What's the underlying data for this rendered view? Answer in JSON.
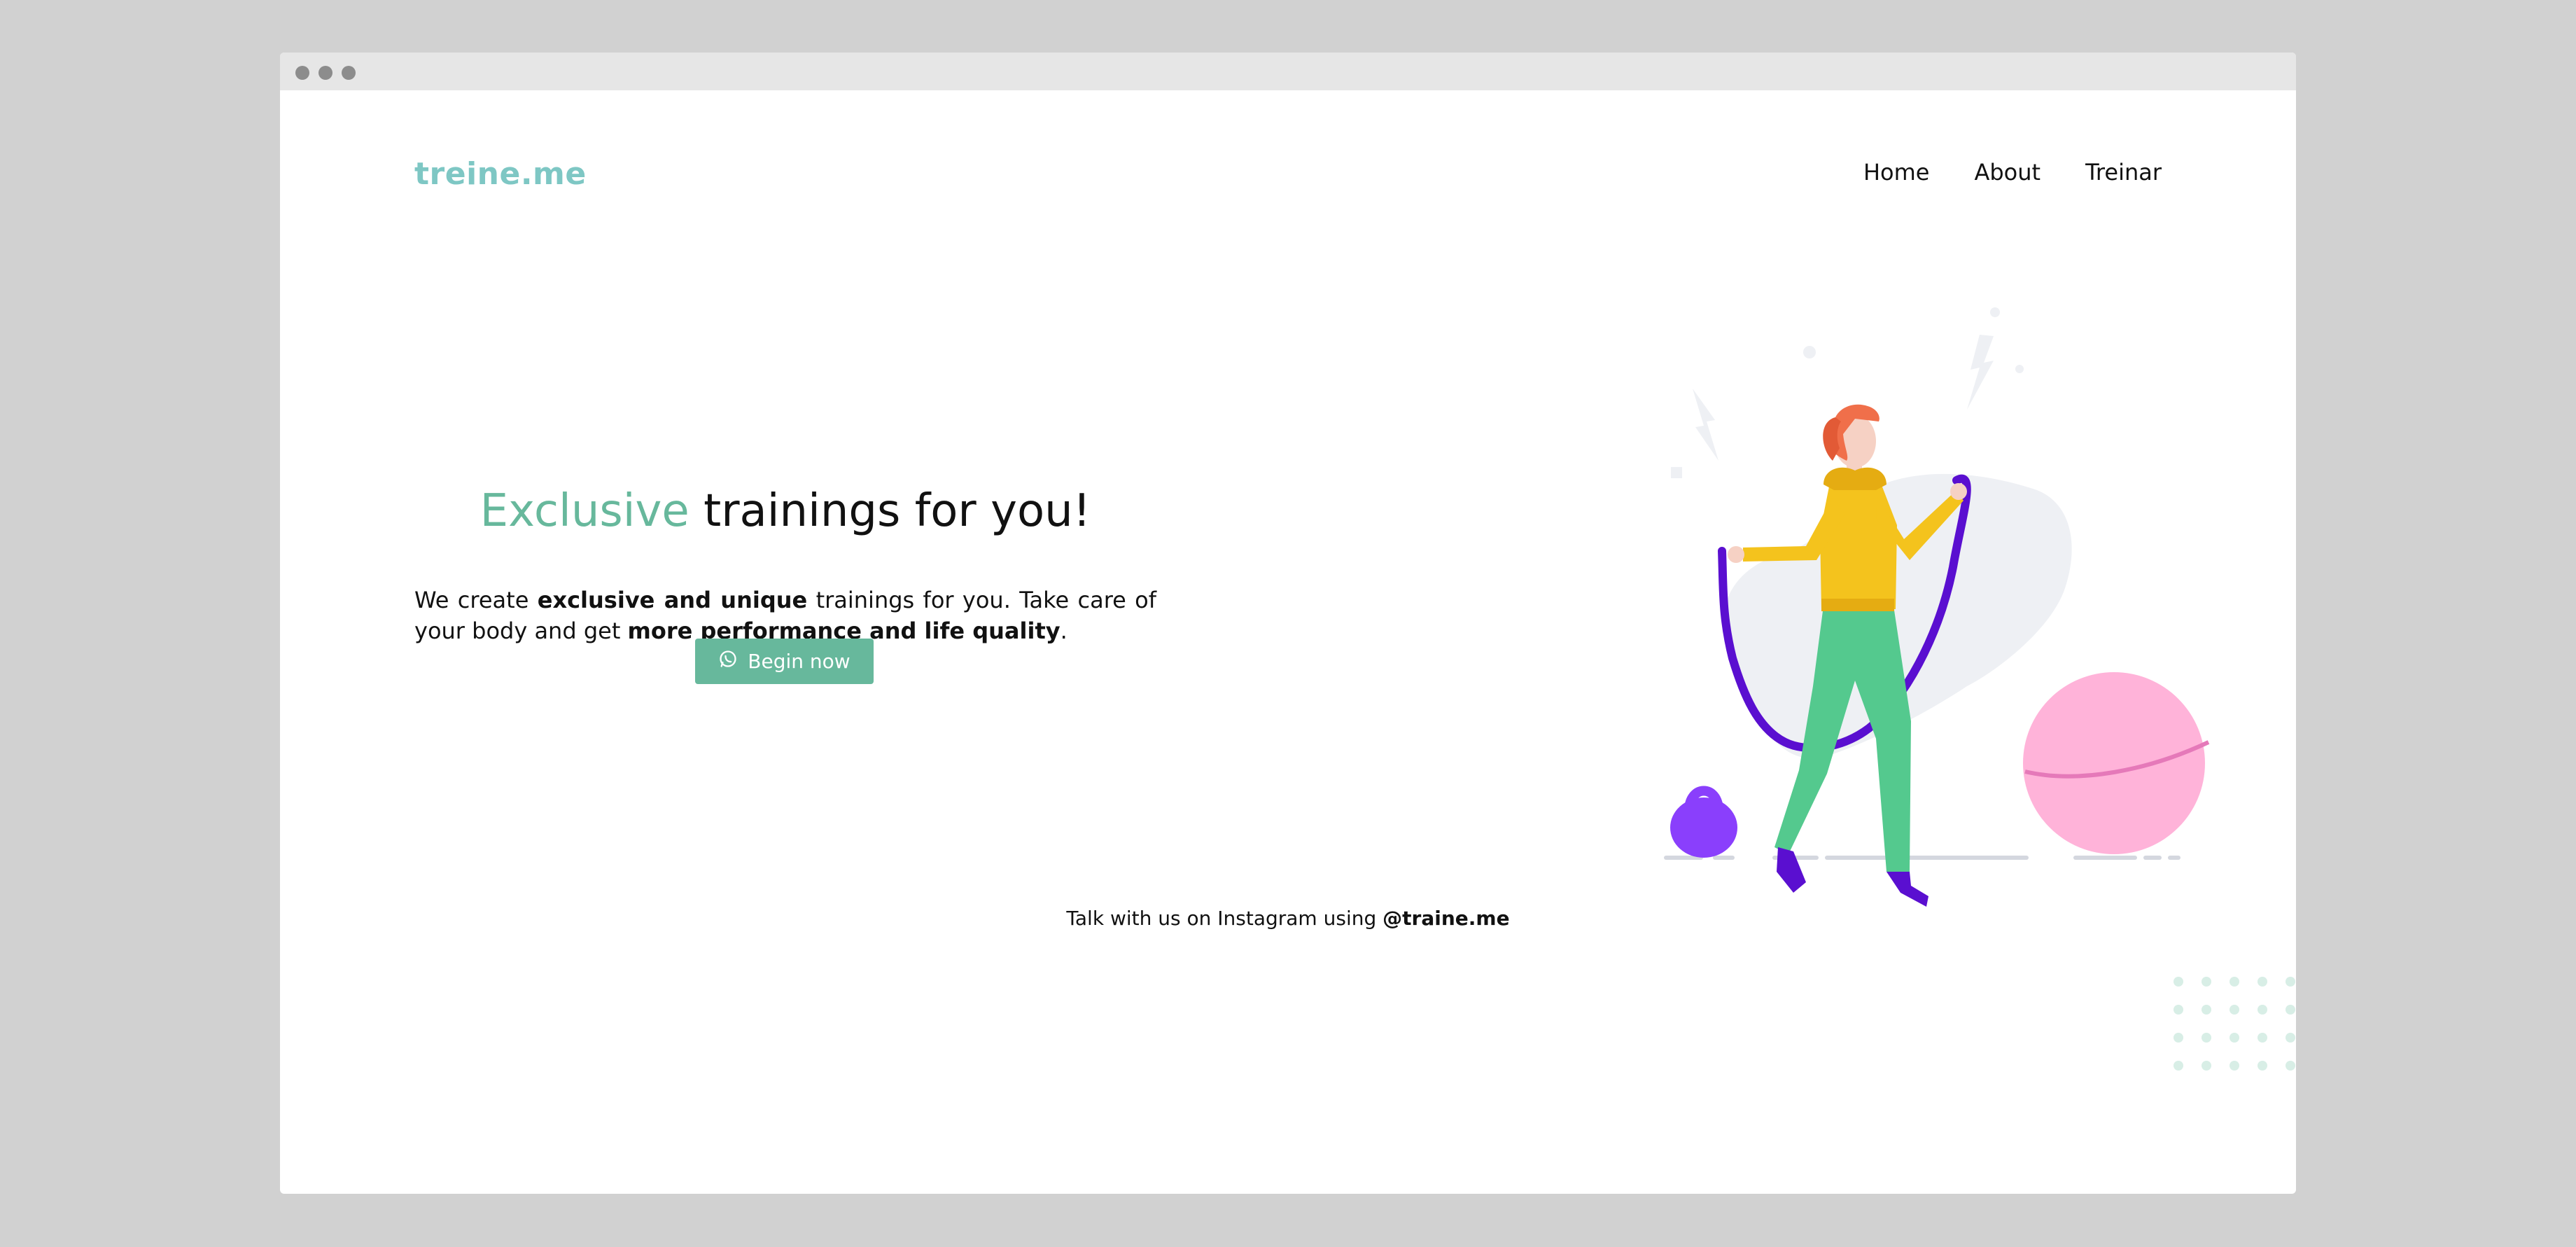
{
  "brand": {
    "logo": "treine.me",
    "accent_color": "#67b89c",
    "logo_color": "#7ec7c4"
  },
  "nav": {
    "items": [
      "Home",
      "About",
      "Treinar"
    ]
  },
  "hero": {
    "title_accent": "Exclusive",
    "title_rest": " trainings for you!",
    "desc_1": "We create ",
    "desc_2": "exclusive and unique",
    "desc_3": " trainings for you. Take care of your body and get ",
    "desc_4": "more performance and life quality",
    "desc_5": ".",
    "cta_label": "Begin now",
    "cta_icon": "whatsapp-icon"
  },
  "footer": {
    "text": "Talk with us on Instagram using ",
    "handle": "@traine.me"
  }
}
